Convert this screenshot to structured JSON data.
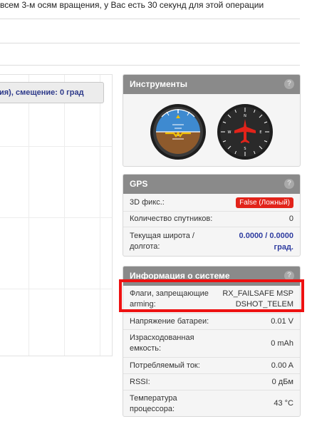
{
  "page": {
    "notice": "всем 3-м осям вращения, у Вас есть 30 секунд для этой операции"
  },
  "left": {
    "offset_button": "ия), смещение: 0 град"
  },
  "instruments": {
    "title": "Инструменты",
    "help": "?",
    "gauges": [
      "attitude-indicator-icon",
      "heading-indicator-icon"
    ]
  },
  "gps": {
    "title": "GPS",
    "help": "?",
    "fix_label": "3D фикс.:",
    "fix_value": "False (Ложный)",
    "sats_label": "Количество спутников:",
    "sats_value": "0",
    "latlon_label": "Текущая широта / долгота:",
    "latlon_value": "0.0000 / 0.0000 град."
  },
  "system": {
    "title": "Информация о системе",
    "help": "?",
    "rows": [
      {
        "label": "Флаги, запрещающие arming:",
        "value": "RX_FAILSAFE  MSP DSHOT_TELEM"
      },
      {
        "label": "Напряжение батареи:",
        "value": "0.01 V"
      },
      {
        "label": "Израсходованная емкость:",
        "value": "0 mAh"
      },
      {
        "label": "Потребляемый ток:",
        "value": "0.00 A"
      },
      {
        "label": "RSSI:",
        "value": "0 дБм"
      },
      {
        "label": "Температура процессора:",
        "value": "43 °C"
      }
    ]
  },
  "colors": {
    "header_bg": "#8a8a8a",
    "accent_blue": "#2e3ca0",
    "danger_red": "#e2231a",
    "highlight": "#ee1111"
  }
}
